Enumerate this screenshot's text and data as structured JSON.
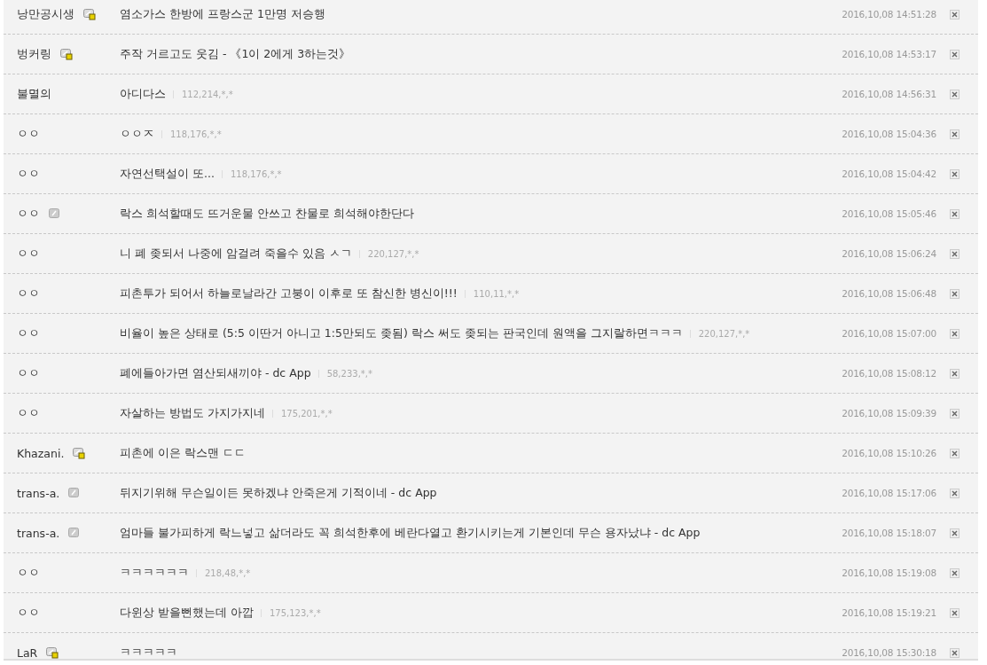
{
  "comments": [
    {
      "name": "낭만공시생",
      "kind": "fixed",
      "text": "염소가스 한방에 프랑스군 1만명 저승행",
      "date": "2016,10,08 14:51:28"
    },
    {
      "name": "벙커링",
      "kind": "fixed",
      "text": "주작 거르고도 웃김 - 《1이 2에게 3하는것》",
      "date": "2016,10,08 14:53:17"
    },
    {
      "name": "불멸의",
      "kind": "plain",
      "text": "아디다스",
      "ip": "112,214,*,*",
      "date": "2016,10,08 14:56:31"
    },
    {
      "name": "ㅇㅇ",
      "kind": "plain",
      "text": "ㅇㅇㅈ",
      "ip": "118,176,*,*",
      "date": "2016,10,08 15:04:36"
    },
    {
      "name": "ㅇㅇ",
      "kind": "plain",
      "text": "자연선택설이 또...",
      "ip": "118,176,*,*",
      "date": "2016,10,08 15:04:42"
    },
    {
      "name": "ㅇㅇ",
      "kind": "half",
      "text": "락스 희석할때도 뜨거운물 안쓰고 찬물로 희석해야한단다",
      "date": "2016,10,08 15:05:46"
    },
    {
      "name": "ㅇㅇ",
      "kind": "plain",
      "text": "니 폐 좆되서 나중에 암걸려 죽을수 있음 ㅅㄱ",
      "ip": "220,127,*,*",
      "date": "2016,10,08 15:06:24"
    },
    {
      "name": "ㅇㅇ",
      "kind": "plain",
      "text": "피촌투가 되어서 하늘로날라간 고붕이 이후로 또 참신한 병신이!!!",
      "ip": "110,11,*,*",
      "date": "2016,10,08 15:06:48"
    },
    {
      "name": "ㅇㅇ",
      "kind": "plain",
      "text": "비율이 높은 상태로 (5:5 이딴거 아니고 1:5만되도 좆됨) 락스 써도 좆되는 판국인데 원액을 그지랄하면ㅋㅋㅋ",
      "ip": "220,127,*,*",
      "date": "2016,10,08 15:07:00"
    },
    {
      "name": "ㅇㅇ",
      "kind": "plain",
      "text": "폐에들아가면 염산되새끼야 - dc App",
      "ip": "58,233,*,*",
      "date": "2016,10,08 15:08:12"
    },
    {
      "name": "ㅇㅇ",
      "kind": "plain",
      "text": "자살하는 방법도 가지가지네",
      "ip": "175,201,*,*",
      "date": "2016,10,08 15:09:39"
    },
    {
      "name": "Khazani.",
      "kind": "fixed",
      "text": "피촌에 이은 락스맨 ㄷㄷ",
      "date": "2016,10,08 15:10:26"
    },
    {
      "name": "trans-a.",
      "kind": "half",
      "text": "뒤지기위해 무슨일이든 못하겠냐 안죽은게 기적이네 - dc App",
      "date": "2016,10,08 15:17:06"
    },
    {
      "name": "trans-a.",
      "kind": "half",
      "text": "엄마들 불가피하게 락느넣고 삶더라도 꼭 희석한후에 베란다열고 환기시키는게 기본인데 무슨 용자났냐 - dc App",
      "date": "2016,10,08 15:18:07"
    },
    {
      "name": "ㅇㅇ",
      "kind": "plain",
      "text": "ㅋㅋㅋㅋㅋㅋ",
      "ip": "218,48,*,*",
      "date": "2016,10,08 15:19:08"
    },
    {
      "name": "ㅇㅇ",
      "kind": "plain",
      "text": "다윈상 받을뻔했는데 아깝",
      "ip": "175,123,*,*",
      "date": "2016,10,08 15:19:21"
    },
    {
      "name": "LaR",
      "kind": "fixed",
      "text": "ㅋㅋㅋㅋㅋ",
      "date": "2016,10,08 15:30:18"
    }
  ]
}
